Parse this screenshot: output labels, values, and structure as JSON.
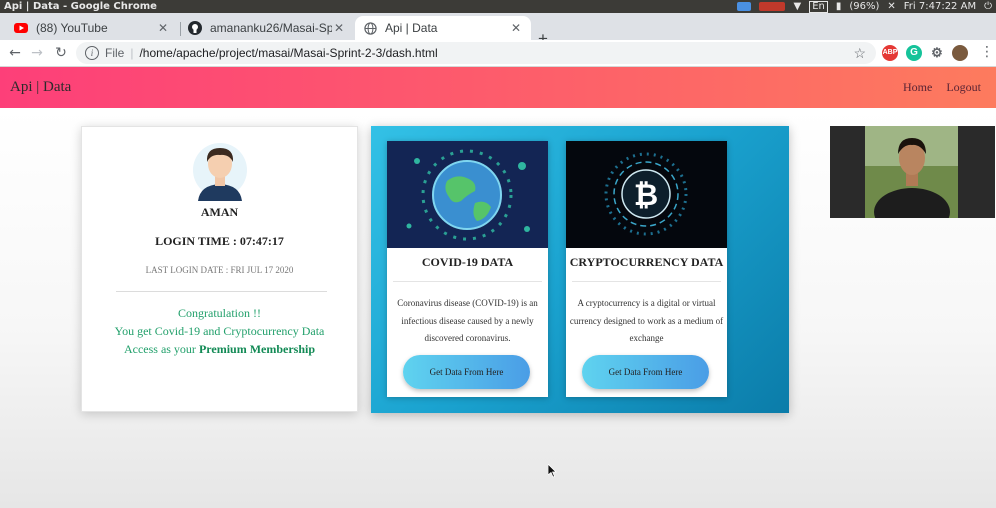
{
  "window": {
    "title": "Api | Data - Google Chrome",
    "tray": {
      "language": "En",
      "battery": "(96%)",
      "clock": "Fri 7:47:22 AM"
    }
  },
  "tabs": [
    {
      "label": "(88) YouTube",
      "icon": "youtube-icon"
    },
    {
      "label": "amananku26/Masai-Sprin",
      "icon": "github-icon"
    },
    {
      "label": "Api | Data",
      "icon": "globe-icon"
    }
  ],
  "address": {
    "scheme_label": "File",
    "url": "/home/apache/project/masai/Masai-Sprint-2-3/dash.html"
  },
  "extensions": {
    "abp_label": "ABP"
  },
  "navbar": {
    "brand": "Api | Data",
    "links": [
      "Home",
      "Logout"
    ]
  },
  "profile": {
    "name": "AMAN",
    "login_time": "LOGIN TIME : 07:47:17",
    "last_login": "LAST LOGIN DATE : FRI JUL 17 2020",
    "congrats_line1": "Congratulation !!",
    "congrats_line2": "You get Covid-19 and Cryptocurrency Data",
    "congrats_line3_prefix": "Access as your ",
    "congrats_line3_bold": "Premium Membership"
  },
  "cards": [
    {
      "title": "COVID-19 DATA",
      "description": "Coronavirus disease (COVID-19) is an infectious disease caused by a newly discovered coronavirus.",
      "button": "Get Data From Here"
    },
    {
      "title": "CRYPTOCURRENCY DATA",
      "description": "A cryptocurrency is a digital or virtual currency designed to work as a medium of exchange",
      "button": "Get Data From Here"
    }
  ],
  "colors": {
    "navbar_start": "#fd3f79",
    "navbar_end": "#fd7b5e",
    "panel_start": "#33c1e6",
    "panel_end": "#0b7ca9",
    "congrats_text": "#22a06b"
  }
}
